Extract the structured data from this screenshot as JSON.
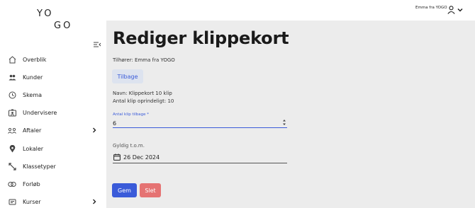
{
  "brand": {
    "line1": "YO",
    "line2": "GO"
  },
  "user": {
    "name": "Emma fra YOGO"
  },
  "sidebar": {
    "items": [
      {
        "label": "Overblik",
        "icon": "home-icon"
      },
      {
        "label": "Kunder",
        "icon": "people-icon"
      },
      {
        "label": "Skema",
        "icon": "clock-icon"
      },
      {
        "label": "Undervisere",
        "icon": "id-card-icon"
      },
      {
        "label": "Aftaler",
        "icon": "group-icon",
        "has_children": true
      },
      {
        "label": "Lokaler",
        "icon": "location-pin-icon"
      },
      {
        "label": "Klassetyper",
        "icon": "tag-arrows-icon"
      },
      {
        "label": "Forløb",
        "icon": "link-icon"
      },
      {
        "label": "Kurser",
        "icon": "course-icon",
        "has_children": true
      }
    ]
  },
  "page": {
    "title": "Rediger klippekort",
    "owner": "Tilhører: Emma fra YOGO",
    "back_label": "Tilbage",
    "name_line": "Navn: Klippekort 10 klip",
    "original_clips_line": "Antal klip oprindeligt: 10",
    "clips_back": {
      "label": "Antal klip tilbage",
      "required_mark": "*",
      "value": "6"
    },
    "valid_until": {
      "label": "Gyldig t.o.m.",
      "value": "26 Dec 2024"
    },
    "save_label": "Gem",
    "delete_label": "Slet"
  },
  "colors": {
    "accent": "#3a5bd9",
    "danger": "#e57373",
    "content_bg": "#ececec",
    "back_button_bg": "#dde3ef"
  }
}
